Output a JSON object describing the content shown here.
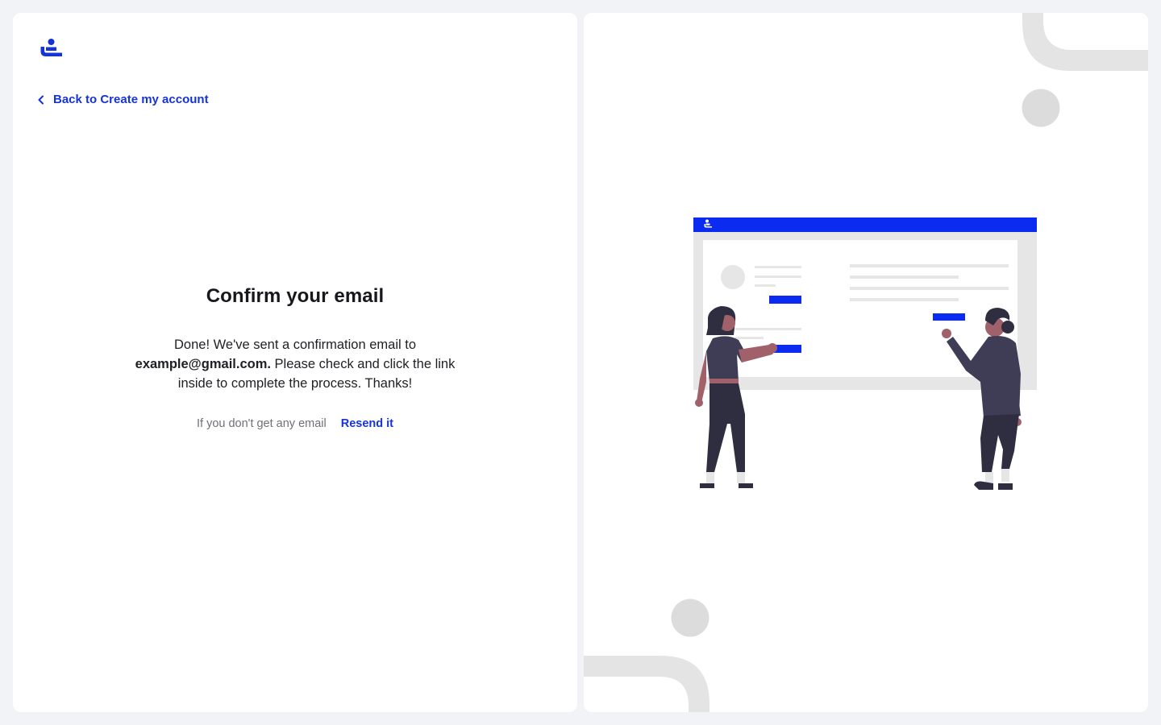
{
  "nav": {
    "back_label": "Back to Create my account"
  },
  "confirm": {
    "title": "Confirm your email",
    "message_before": "Done! We've sent a confirmation email to ",
    "email": "example@gmail.com.",
    "message_after": " Please check and click the link inside to complete the process. Thanks!",
    "resend_hint": "If you don't get any email",
    "resend_label": "Resend it"
  },
  "icons": {
    "logo": "brand-logo-icon",
    "back": "chevron-left-icon"
  },
  "colors": {
    "accent": "#1634d6",
    "illustration_blue": "#0b2bf0",
    "background": "#f2f3f7",
    "deco_gray": "#e4e4e4"
  }
}
